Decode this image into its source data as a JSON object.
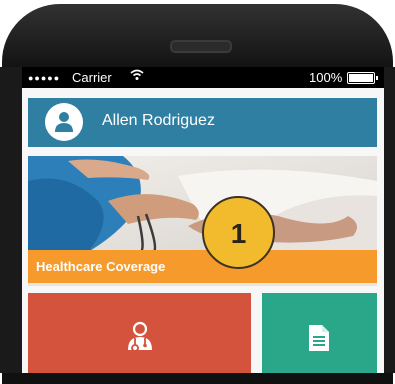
{
  "status_bar": {
    "signal_dots": "●●●●●",
    "carrier": "Carrier",
    "wifi_icon": "wifi-icon",
    "battery_text": "100%",
    "battery_level": 1.0
  },
  "user": {
    "avatar_icon": "user-icon",
    "name": "Allen Rodriguez"
  },
  "hero": {
    "caption": "Healthcare Coverage",
    "badge_number": "1"
  },
  "tiles": [
    {
      "icon": "doctor-icon",
      "color": "#d4533d"
    },
    {
      "icon": "document-icon",
      "color": "#2aa688"
    }
  ],
  "colors": {
    "user_bar": "#2f7fa3",
    "caption_bar": "#f59a2b",
    "badge": "#f2bb2e"
  }
}
